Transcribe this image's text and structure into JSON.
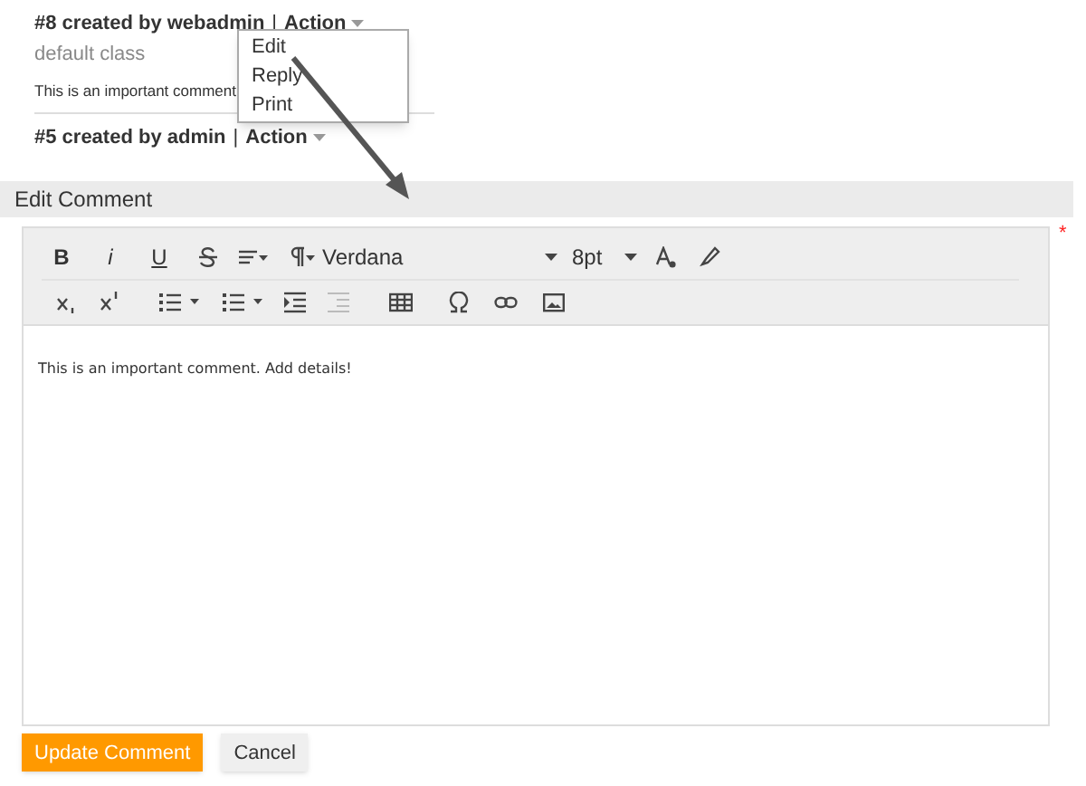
{
  "comments": [
    {
      "header": "#8 created by webadmin",
      "separator": "|",
      "action": "Action",
      "class": "default class",
      "body": "This is an important comment"
    },
    {
      "header": "#5 created by admin",
      "separator": "|",
      "action": "Action"
    }
  ],
  "action_menu": {
    "items": [
      "Edit",
      "Reply",
      "Print"
    ]
  },
  "editor": {
    "title": "Edit Comment",
    "required_mark": "*",
    "format_buttons": [
      "B",
      "i",
      "U"
    ],
    "font": "Verdana",
    "size": "8pt",
    "content": "This is an important comment. Add details!"
  },
  "buttons": [
    {
      "label": "Update Comment",
      "kind": "primary"
    },
    {
      "label": "Cancel",
      "kind": "secondary"
    }
  ]
}
